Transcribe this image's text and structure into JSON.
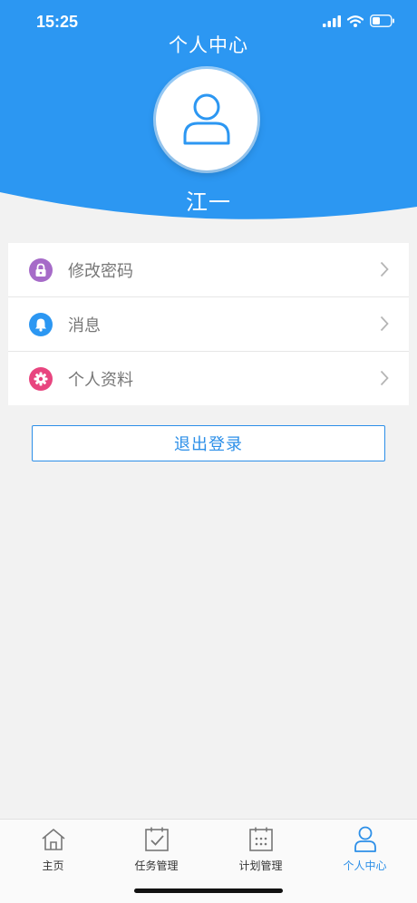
{
  "status": {
    "time": "15:25"
  },
  "header": {
    "title": "个人中心",
    "username": "江一",
    "bg_color": "#2c97f2"
  },
  "menu": {
    "items": [
      {
        "label": "修改密码",
        "icon": "lock-icon",
        "color": "#a66bc8"
      },
      {
        "label": "消息",
        "icon": "bell-icon",
        "color": "#2c97f2"
      },
      {
        "label": "个人资料",
        "icon": "gear-icon",
        "color": "#e8457f"
      }
    ]
  },
  "logout": {
    "label": "退出登录"
  },
  "tabbar": {
    "tabs": [
      {
        "label": "主页",
        "icon": "home-icon",
        "active": false
      },
      {
        "label": "任务管理",
        "icon": "task-check-icon",
        "active": false
      },
      {
        "label": "计划管理",
        "icon": "calendar-icon",
        "active": false
      },
      {
        "label": "个人中心",
        "icon": "person-icon",
        "active": true
      }
    ]
  },
  "colors": {
    "accent": "#2c8fe8",
    "background": "#f2f2f2"
  }
}
